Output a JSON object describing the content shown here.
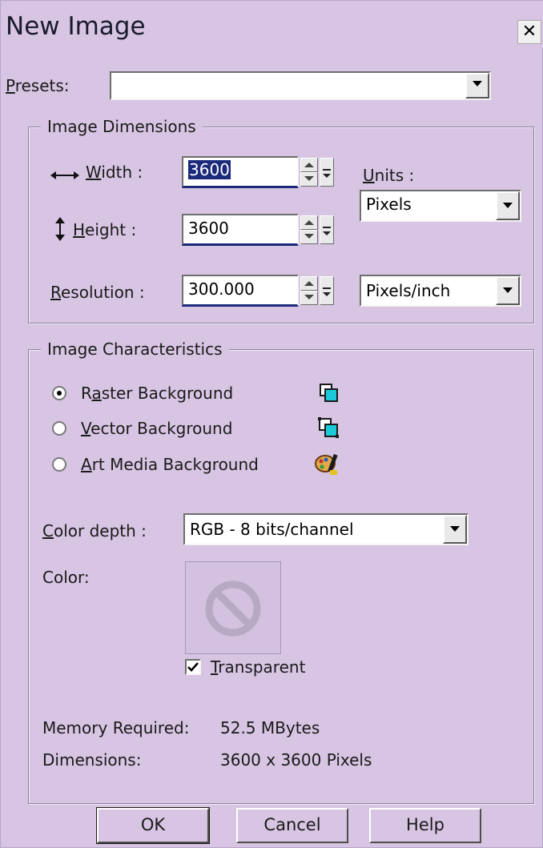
{
  "window": {
    "title": "New Image",
    "close_glyph": "✕"
  },
  "presets": {
    "label_prefix": "P",
    "label_rest": "resets:",
    "value": ""
  },
  "image_dimensions": {
    "legend": "Image Dimensions",
    "width": {
      "label_u": "W",
      "label_rest": "idth :",
      "value": "3600"
    },
    "height": {
      "label_u": "H",
      "label_rest": "eight :",
      "value": "3600"
    },
    "resolution": {
      "label_u": "R",
      "label_rest": "esolution :",
      "value": "300.000"
    },
    "units": {
      "label_u": "U",
      "label_rest": "nits :",
      "value": "Pixels"
    },
    "resolution_units": {
      "value": "Pixels/inch"
    }
  },
  "image_characteristics": {
    "legend": "Image Characteristics",
    "backgrounds": [
      {
        "pre": "R",
        "u": "a",
        "post": "ster Background",
        "checked": true,
        "icon": "raster-layer-icon"
      },
      {
        "pre": "",
        "u": "V",
        "post": "ector Background",
        "checked": false,
        "icon": "vector-layer-icon"
      },
      {
        "pre": "",
        "u": "A",
        "post": "rt Media Background",
        "checked": false,
        "icon": "art-media-layer-icon"
      }
    ],
    "color_depth": {
      "label_u": "C",
      "label_rest": "olor depth :",
      "value": "RGB - 8 bits/channel"
    },
    "color": {
      "label": "Color:"
    },
    "transparent": {
      "label_u": "T",
      "label_rest": "ransparent",
      "checked": true
    },
    "memory": {
      "label": "Memory Required:",
      "value": "52.5 MBytes"
    },
    "dimensions": {
      "label": "Dimensions:",
      "value": "3600 x 3600 Pixels"
    }
  },
  "buttons": {
    "ok": "OK",
    "cancel": "Cancel",
    "help": "Help"
  },
  "colors": {
    "background": "#d7c5e3",
    "selection": "#1b2a7a",
    "accent_icon": "#1cc9d8"
  }
}
